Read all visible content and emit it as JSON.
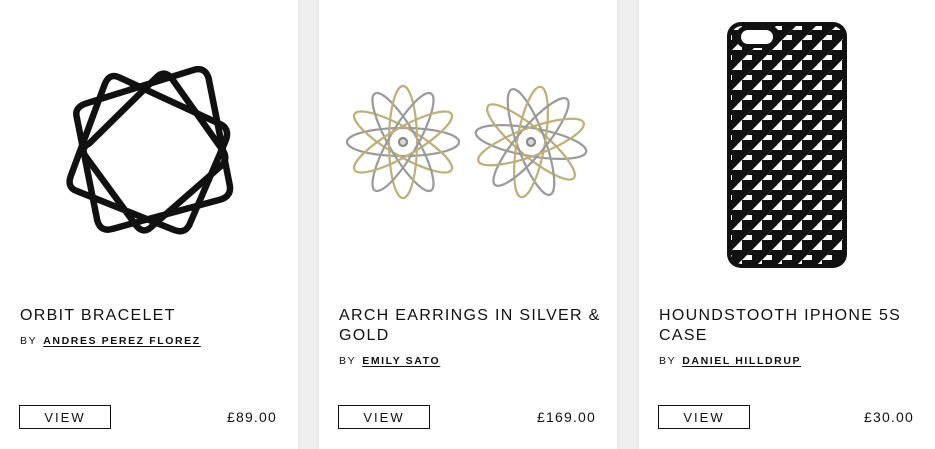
{
  "products": [
    {
      "image": "orbit-bracelet-image",
      "title": "ORBIT BRACELET",
      "by_label": "BY",
      "designer": "ANDRES PEREZ FLOREZ",
      "view_label": "VIEW",
      "price": "£89.00"
    },
    {
      "image": "arch-earrings-image",
      "title": "ARCH EARRINGS IN SILVER & GOLD",
      "by_label": "BY",
      "designer": "EMILY SATO",
      "view_label": "VIEW",
      "price": "£169.00"
    },
    {
      "image": "houndstooth-phone-case-image",
      "title": "HOUNDSTOOTH IPHONE 5S CASE",
      "by_label": "BY",
      "designer": "DANIEL HILLDRUP",
      "view_label": "VIEW",
      "price": "£30.00"
    }
  ],
  "colors": {
    "background": "#efefef",
    "card": "#ffffff",
    "text": "#111111"
  }
}
